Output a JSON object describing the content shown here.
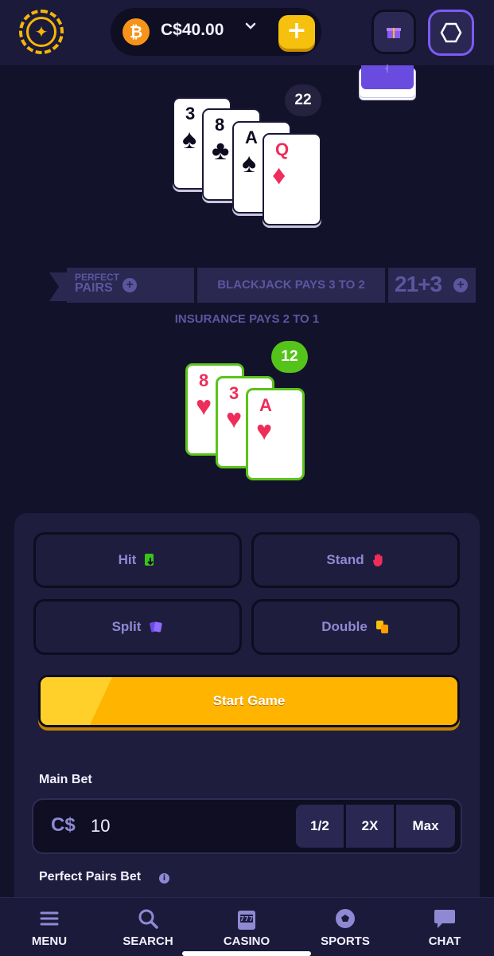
{
  "header": {
    "balance": "C$40.00",
    "btc_symbol": "₿",
    "plus_label": "+"
  },
  "dealer": {
    "count": "22",
    "cards": [
      {
        "rank": "3",
        "suit": "♠",
        "color": "black"
      },
      {
        "rank": "8",
        "suit": "♣",
        "color": "black"
      },
      {
        "rank": "A",
        "suit": "♠",
        "color": "black"
      },
      {
        "rank": "Q",
        "suit": "♦",
        "color": "red"
      }
    ]
  },
  "banner": {
    "pp_line1": "PERFECT",
    "pp_line2": "PAIRS",
    "blackjack": "BLACKJACK PAYS 3 TO 2",
    "side": "21+3",
    "insurance": "INSURANCE PAYS 2 TO 1"
  },
  "player": {
    "count": "12",
    "cards": [
      {
        "rank": "8",
        "suit": "♥",
        "color": "red"
      },
      {
        "rank": "3",
        "suit": "♥",
        "color": "red"
      },
      {
        "rank": "A",
        "suit": "♥",
        "color": "red"
      }
    ]
  },
  "actions": {
    "hit": "Hit",
    "stand": "Stand",
    "split": "Split",
    "double": "Double",
    "start": "Start Game"
  },
  "bet": {
    "main_label": "Main Bet",
    "currency": "C$",
    "value": "10",
    "half": "1/2",
    "double": "2X",
    "max": "Max",
    "pp_label": "Perfect Pairs Bet"
  },
  "nav": {
    "menu": "MENU",
    "search": "SEARCH",
    "casino": "CASINO",
    "sports": "SPORTS",
    "chat": "CHAT"
  },
  "colors": {
    "accent": "#f6c10e",
    "win": "#55c41a",
    "bg": "#13122b"
  }
}
